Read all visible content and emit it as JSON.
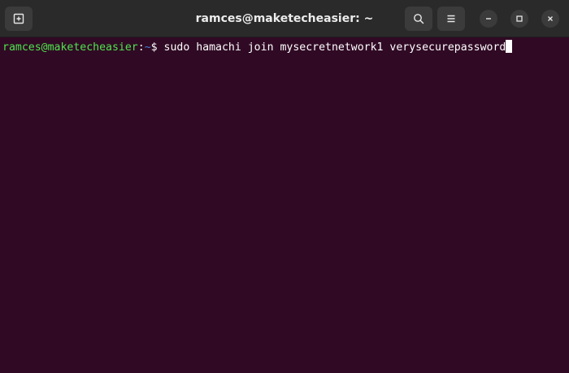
{
  "window": {
    "title": "ramces@maketecheasier: ~"
  },
  "header": {
    "new_tab_icon": "new-tab-icon",
    "search_icon": "search-icon",
    "menu_icon": "hamburger-menu-icon",
    "minimize_icon": "minimize-icon",
    "maximize_icon": "maximize-icon",
    "close_icon": "close-icon"
  },
  "terminal": {
    "prompt_user": "ramces@maketecheasier",
    "prompt_colon": ":",
    "prompt_path": "~",
    "prompt_symbol": "$ ",
    "command": "sudo hamachi join mysecretnetwork1 verysecurepassword"
  },
  "colors": {
    "background": "#300a24",
    "titlebar": "#2a2a2a",
    "prompt_user": "#4ee44e",
    "prompt_path": "#3f7fd6",
    "text": "#ffffff"
  }
}
